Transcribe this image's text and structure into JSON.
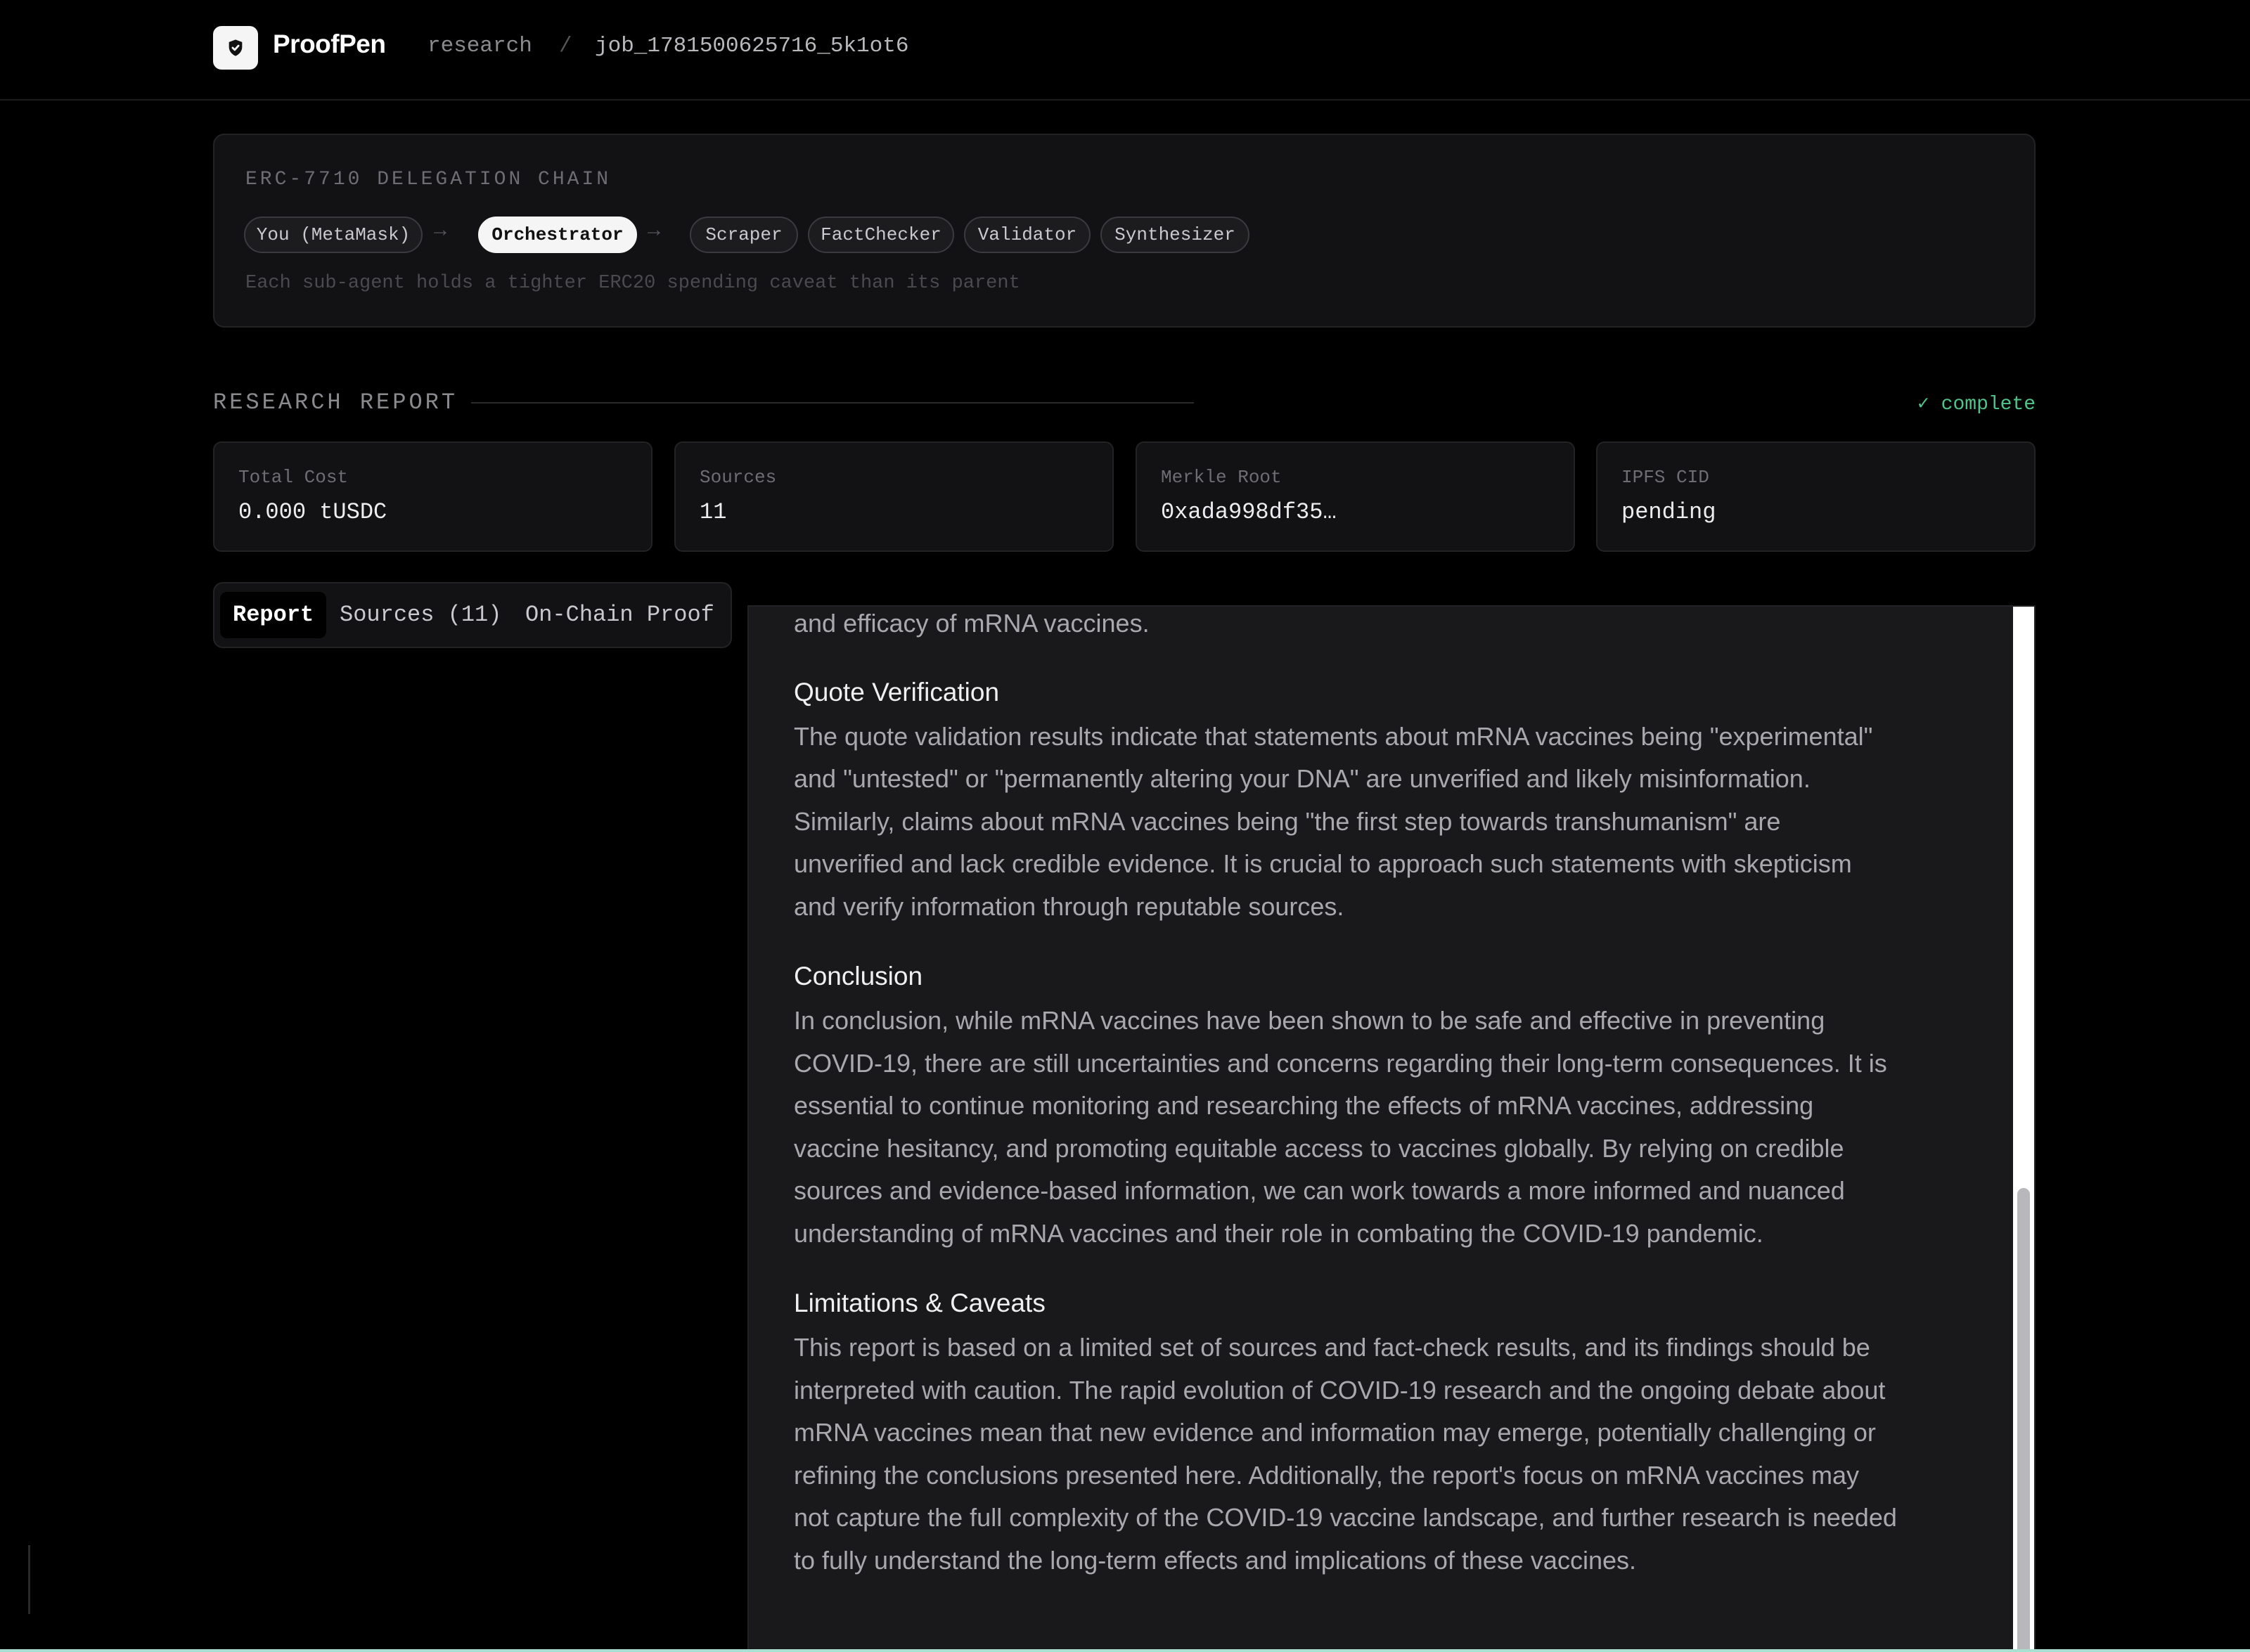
{
  "header": {
    "brand": "ProofPen",
    "breadcrumb": [
      "research",
      "/",
      "job_1781500625716_5k1ot6"
    ]
  },
  "delegation": {
    "title": "ERC-7710 DELEGATION CHAIN",
    "agents": [
      "You (MetaMask)",
      "Orchestrator",
      "Scraper",
      "FactChecker",
      "Validator",
      "Synthesizer"
    ],
    "active_agent": "Orchestrator",
    "arrow": "→",
    "note": "Each sub-agent holds a tighter ERC20 spending caveat than its parent"
  },
  "report_header": {
    "title": "RESEARCH REPORT",
    "status": "✓ complete",
    "status_color": "#4fc38a"
  },
  "stats": [
    {
      "label": "Total Cost",
      "value": "0.000 tUSDC"
    },
    {
      "label": "Sources",
      "value": "11"
    },
    {
      "label": "Merkle Root",
      "value": "0xada998df35…"
    },
    {
      "label": "IPFS CID",
      "value": "pending"
    }
  ],
  "tabs": [
    {
      "label": "Report",
      "active": true
    },
    {
      "label": "Sources (11)",
      "active": false
    },
    {
      "label": "On-Chain Proof",
      "active": false
    }
  ],
  "report": {
    "intro_tail": "and efficacy of mRNA vaccines.",
    "sections": [
      {
        "heading": "Quote Verification",
        "lines": [
          "The quote validation results indicate that statements about mRNA vaccines being \"experimental\"",
          "and \"untested\" or \"permanently altering your DNA\" are unverified and likely misinformation.",
          "Similarly, claims about mRNA vaccines being \"the first step towards transhumanism\" are",
          "unverified and lack credible evidence. It is crucial to approach such statements with skepticism",
          "and verify information through reputable sources."
        ]
      },
      {
        "heading": "Conclusion",
        "lines": [
          "In conclusion, while mRNA vaccines have been shown to be safe and effective in preventing",
          "COVID-19, there are still uncertainties and concerns regarding their long-term consequences. It is",
          "essential to continue monitoring and researching the effects of mRNA vaccines, addressing",
          "vaccine hesitancy, and promoting equitable access to vaccines globally. By relying on credible",
          "sources and evidence-based information, we can work towards a more informed and nuanced",
          "understanding of mRNA vaccines and their role in combating the COVID-19 pandemic."
        ]
      },
      {
        "heading": "Limitations & Caveats",
        "lines": [
          "This report is based on a limited set of sources and fact-check results, and its findings should be",
          "interpreted with caution. The rapid evolution of COVID-19 research and the ongoing debate about",
          "mRNA vaccines mean that new evidence and information may emerge, potentially challenging or",
          "refining the conclusions presented here. Additionally, the report's focus on mRNA vaccines may",
          "not capture the full complexity of the COVID-19 vaccine landscape, and further research is needed",
          "to fully understand the long-term effects and implications of these vaccines."
        ]
      }
    ]
  },
  "icons": {
    "logo": "shield-check-icon"
  }
}
